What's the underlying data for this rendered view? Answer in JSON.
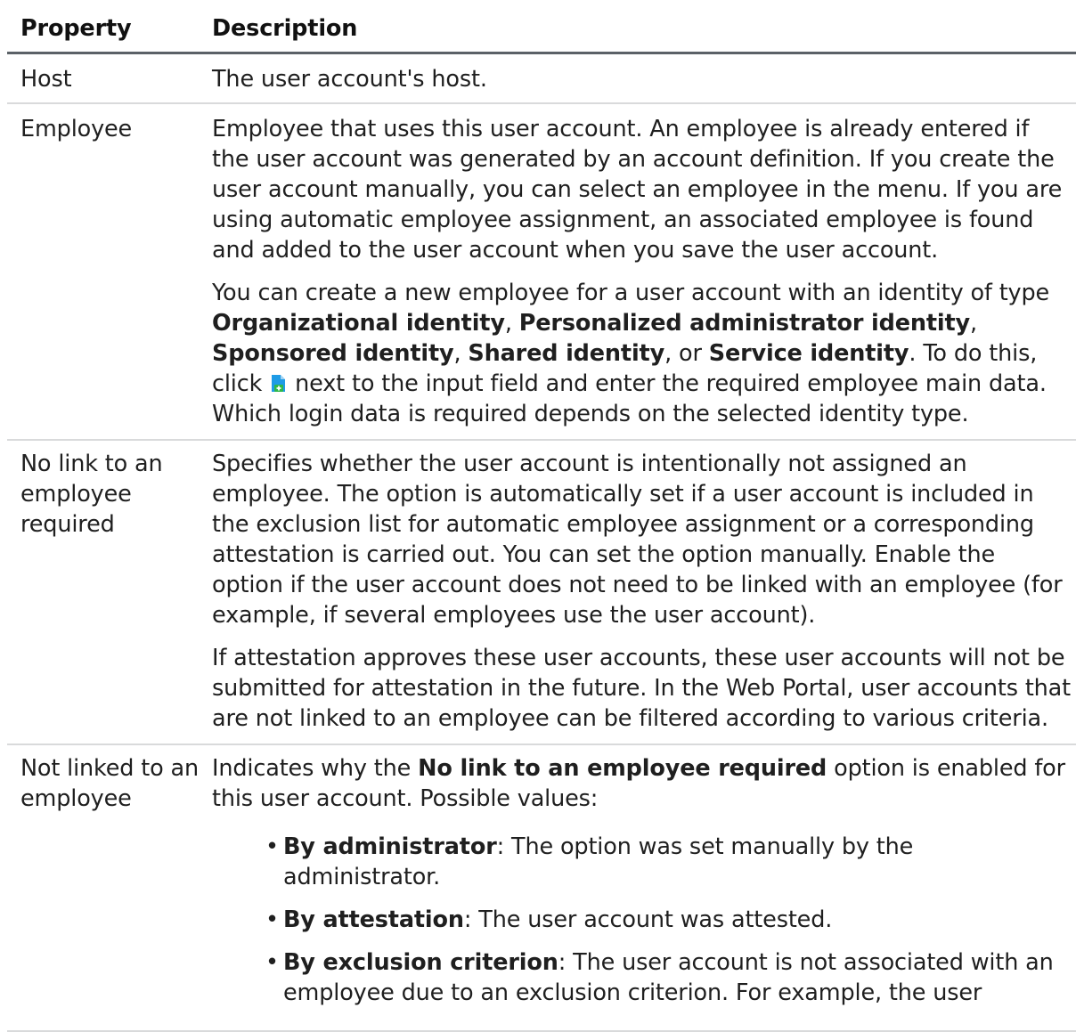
{
  "table": {
    "header": {
      "property": "Property",
      "description": "Description"
    },
    "rows": {
      "host": {
        "property": "Host",
        "description": "The user account's host."
      },
      "employee": {
        "property": "Employee",
        "p1": "Employee that uses this user account. An employee is already entered if the user account was generated by an account definition. If you create the user account manually, you can select an employee in the menu. If you are using automatic employee assignment, an associated employee is found and added to the user account when you save the user account.",
        "p2_a": "You can create a new employee for a user account with an identity of type ",
        "p2_b1": "Organizational identity",
        "p2_c1": ", ",
        "p2_b2": "Personalized administrator identity",
        "p2_c2": ", ",
        "p2_b3": "Sponsored identity",
        "p2_c3": ", ",
        "p2_b4": "Shared identity",
        "p2_c4": ", or ",
        "p2_b5": "Service identity",
        "p2_c5": ". To do this, click ",
        "p2_d": " next to the input field and enter the required employee main data. Which login data is required depends on the selected identity type.",
        "add_icon": "add-employee-icon"
      },
      "no_link": {
        "property": "No link to an employee required",
        "p1": "Specifies whether the user account is intentionally not assigned an employee. The option is automatically set if a user account is included in the exclusion list for automatic employee assignment or a corresponding attestation is carried out. You can set the option manually. Enable the option if the user account does not need to be linked with an employee (for example, if several employees use the user account).",
        "p2": "If attestation approves these user accounts, these user accounts will not be submitted for attestation in the future. In the Web Portal, user accounts that are not linked to an employee can be filtered according to various criteria."
      },
      "not_linked": {
        "property": "Not linked to an employee",
        "p1_a": "Indicates why the ",
        "p1_b": "No link to an employee required",
        "p1_c": " option is enabled for this user account. Possible values:",
        "values": [
          {
            "term": "By administrator",
            "text": ": The option was set manually by the administrator."
          },
          {
            "term": "By attestation",
            "text": ": The user account was attested."
          },
          {
            "term": "By exclusion criterion",
            "text": ": The user account is not associated with an employee due to an exclusion criterion. For example, the user"
          }
        ]
      }
    }
  }
}
